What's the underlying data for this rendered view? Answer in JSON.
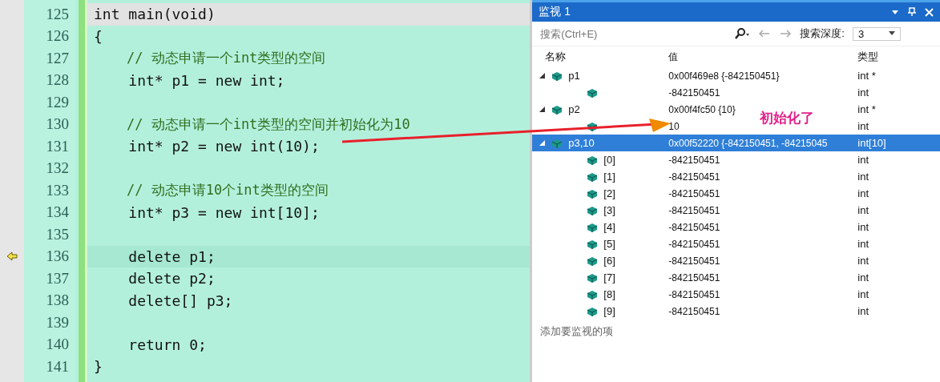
{
  "editor": {
    "lines": [
      {
        "number": "125",
        "code": "int main(void)",
        "kind": "code",
        "current": false
      },
      {
        "number": "126",
        "code": "{",
        "kind": "code",
        "current": false
      },
      {
        "number": "127",
        "code": "    // 动态申请一个int类型的空间",
        "kind": "comment",
        "current": false
      },
      {
        "number": "128",
        "code": "    int* p1 = new int;",
        "kind": "code",
        "current": false
      },
      {
        "number": "129",
        "current": false
      },
      {
        "number": "130",
        "code": "    // 动态申请一个int类型的空间并初始化为10",
        "kind": "comment",
        "current": false
      },
      {
        "number": "131",
        "code": "    int* p2 = new int(10);",
        "kind": "code",
        "current": false
      },
      {
        "number": "132",
        "current": false
      },
      {
        "number": "133",
        "code": "    // 动态申请10个int类型的空间",
        "kind": "comment",
        "current": false
      },
      {
        "number": "134",
        "code": "    int* p3 = new int[10];",
        "kind": "code",
        "current": false
      },
      {
        "number": "135",
        "current": false
      },
      {
        "number": "136",
        "code": "    delete p1;",
        "kind": "code",
        "current": true
      },
      {
        "number": "137",
        "code": "    delete p2;",
        "kind": "code",
        "current": false
      },
      {
        "number": "138",
        "code": "    delete[] p3;",
        "kind": "code",
        "current": false
      },
      {
        "number": "139",
        "current": false
      },
      {
        "number": "140",
        "code": "    return 0;",
        "kind": "code",
        "current": false
      },
      {
        "number": "141",
        "code": "}",
        "kind": "code",
        "current": false
      }
    ]
  },
  "watch": {
    "title": "监视 1",
    "search": {
      "placeholder": "搜索(Ctrl+E)"
    },
    "depth_label": "搜索深度:",
    "depth_value": "3",
    "columns": [
      "名称",
      "值",
      "类型"
    ],
    "rows": [
      {
        "name": "p1",
        "value": "0x00f469e8 {-842150451}",
        "type": "int *",
        "expanded": true,
        "selected": false,
        "children": [
          {
            "value": "-842150451",
            "type": "int",
            "selected": false
          }
        ]
      },
      {
        "name": "p2",
        "value": "0x00f4fc50 {10}",
        "type": "int *",
        "expanded": true,
        "selected": false,
        "children": [
          {
            "value": "10",
            "type": "int",
            "selected": false
          }
        ]
      },
      {
        "name": "p3,10",
        "value": "0x00f52220 {-842150451, -84215045",
        "type": "int[10]",
        "expanded": true,
        "selected": true,
        "children": [
          {
            "name": "[0]",
            "value": "-842150451",
            "type": "int",
            "selected": false
          },
          {
            "name": "[1]",
            "value": "-842150451",
            "type": "int",
            "selected": false
          },
          {
            "name": "[2]",
            "value": "-842150451",
            "type": "int",
            "selected": false
          },
          {
            "name": "[3]",
            "value": "-842150451",
            "type": "int",
            "selected": false
          },
          {
            "name": "[4]",
            "value": "-842150451",
            "type": "int",
            "selected": false
          },
          {
            "name": "[5]",
            "value": "-842150451",
            "type": "int",
            "selected": false
          },
          {
            "name": "[6]",
            "value": "-842150451",
            "type": "int",
            "selected": false
          },
          {
            "name": "[7]",
            "value": "-842150451",
            "type": "int",
            "selected": false
          },
          {
            "name": "[8]",
            "value": "-842150451",
            "type": "int",
            "selected": false
          },
          {
            "name": "[9]",
            "value": "-842150451",
            "type": "int",
            "selected": false
          }
        ]
      }
    ],
    "add_placeholder": "添加要监视的项"
  },
  "annotation": {
    "text": "初始化了"
  }
}
